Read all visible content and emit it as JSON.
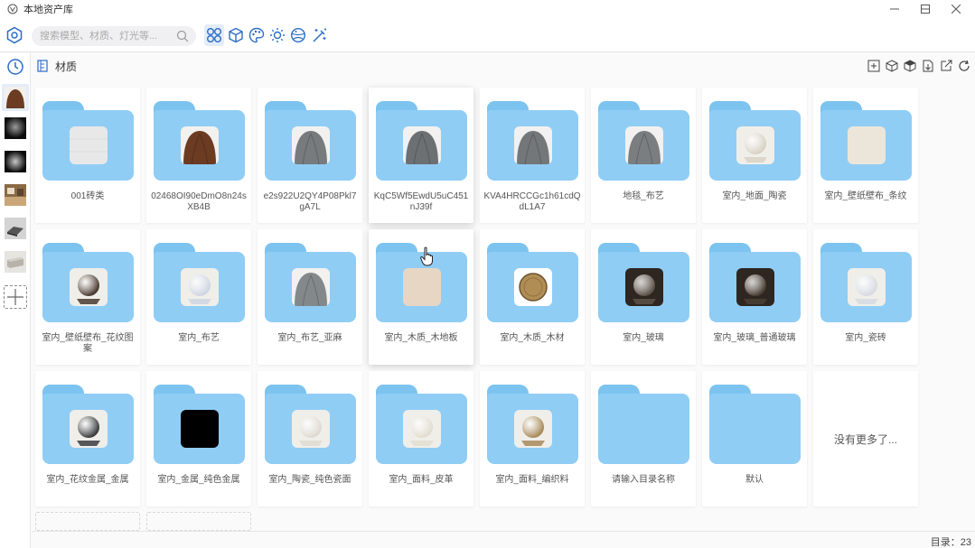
{
  "window": {
    "title": "本地资产库",
    "controls": [
      "minimize",
      "maximize",
      "close"
    ]
  },
  "toolbar": {
    "search_placeholder": "搜索模型、材质、灯光等...",
    "type_buttons": [
      {
        "icon": "grid-icon",
        "active": true
      },
      {
        "icon": "cube-icon",
        "active": false
      },
      {
        "icon": "palette-icon",
        "active": false
      },
      {
        "icon": "sun-icon",
        "active": false
      },
      {
        "icon": "sphere-icon",
        "active": false
      },
      {
        "icon": "magic-wand-icon",
        "active": false
      }
    ]
  },
  "sidebar": {
    "items": [
      {
        "icon": "history-icon"
      },
      {
        "thumb": "brown-cloth"
      },
      {
        "thumb": "dark-light"
      },
      {
        "thumb": "dark-light-2"
      },
      {
        "thumb": "wood-room"
      },
      {
        "thumb": "gray-object"
      },
      {
        "thumb": "gray-box"
      },
      {
        "icon": "add-icon"
      }
    ]
  },
  "path": {
    "label": "材质"
  },
  "actions": [
    "new-folder-icon",
    "box-icon",
    "box-filled-icon",
    "import-icon",
    "export-icon",
    "refresh-icon"
  ],
  "folders": [
    {
      "name": "001砖类",
      "thumb": "light-tile",
      "color": "#e8e8e8"
    },
    {
      "name": "02468OI90eDmO8n24sXB4B",
      "thumb": "brown-cloth",
      "color": "#6b3b22"
    },
    {
      "name": "e2s922U2QY4P08Pkl7gA7L",
      "thumb": "gray-cloth",
      "color": "#777b7e"
    },
    {
      "name": "KqC5Wf5EwdU5uC451nJ39f",
      "thumb": "gray-cloth",
      "color": "#6c7072"
    },
    {
      "name": "KVA4HRCCGc1h61cdQdL1A7",
      "thumb": "gray-cloth",
      "color": "#74777a"
    },
    {
      "name": "地毯_布艺",
      "thumb": "gray-cloth",
      "color": "#7a7e80"
    },
    {
      "name": "室内_地面_陶瓷",
      "thumb": "ceramic-sphere",
      "color": "#d8d2c6"
    },
    {
      "name": "室内_壁纸壁布_条纹",
      "thumb": "cream-fabric",
      "color": "#ece6da"
    },
    {
      "name": "室内_壁纸壁布_花纹图案",
      "thumb": "dark-sphere",
      "color": "#4a3a30"
    },
    {
      "name": "室内_布艺",
      "thumb": "white-sphere",
      "color": "#cfd6e2"
    },
    {
      "name": "室内_布艺_亚麻",
      "thumb": "gray-cloth",
      "color": "#83888b"
    },
    {
      "name": "室内_木质_木地板",
      "thumb": "beige-wood",
      "color": "#e6d6c3"
    },
    {
      "name": "室内_木质_木材",
      "thumb": "wood-disc",
      "color": "#b08d55"
    },
    {
      "name": "室内_玻璃",
      "thumb": "glass-sphere",
      "color": "#5d5248"
    },
    {
      "name": "室内_玻璃_普通玻璃",
      "thumb": "glass-sphere",
      "color": "#4a3f35"
    },
    {
      "name": "室内_瓷砖",
      "thumb": "white-sphere",
      "color": "#d6dbe2"
    },
    {
      "name": "室内_花纹金属_金属",
      "thumb": "black-metal-sphere",
      "color": "#3a3c3e"
    },
    {
      "name": "室内_金属_纯色金属",
      "thumb": "black-square",
      "color": "#000000"
    },
    {
      "name": "室内_陶瓷_纯色瓷面",
      "thumb": "ceramic-sphere",
      "color": "#dedad2"
    },
    {
      "name": "室内_面料_皮革",
      "thumb": "ceramic-sphere",
      "color": "#e2ddd0"
    },
    {
      "name": "室内_面料_编织料",
      "thumb": "woven-sphere",
      "color": "#a88a5a"
    },
    {
      "name": "请输入目录名称",
      "thumb": "",
      "color": ""
    },
    {
      "name": "默认",
      "thumb": "",
      "color": ""
    }
  ],
  "no_more_text": "没有更多了...",
  "status": {
    "count_label": "目录：23"
  }
}
